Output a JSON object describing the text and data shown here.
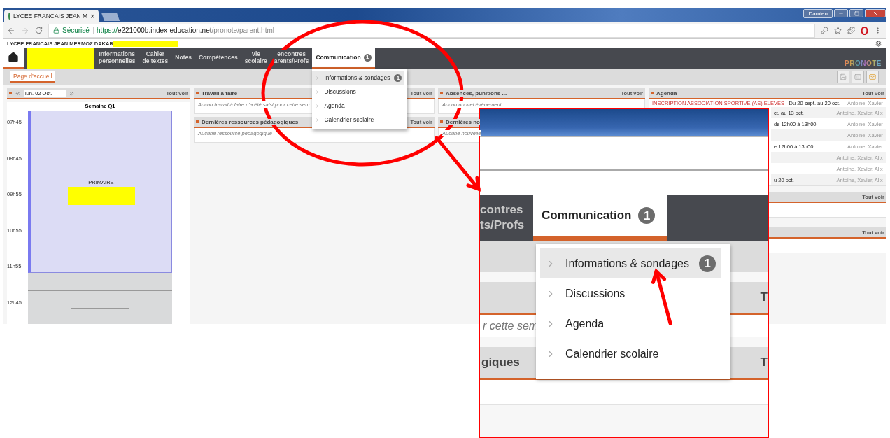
{
  "browser": {
    "tab_title": "LYCEE FRANCAIS JEAN M",
    "tab_close": "×",
    "user": "Damien",
    "secure_label": "Sécurisé",
    "url_scheme": "https://",
    "url_host": "e221000b.index-education.net",
    "url_path": "/pronote/parent.html"
  },
  "school_name": "LYCEE FRANCAIS JEAN MERMOZ DAKAR",
  "nav": {
    "items": [
      {
        "lines": [
          "Informations",
          "personnelles"
        ],
        "selected": false
      },
      {
        "lines": [
          "Cahier",
          "de textes"
        ],
        "selected": false
      },
      {
        "lines": [
          "Notes"
        ],
        "selected": false
      },
      {
        "lines": [
          "Compétences"
        ],
        "selected": false
      },
      {
        "lines": [
          "Vie",
          "scolaire"
        ],
        "selected": false
      },
      {
        "lines": [
          "encontres",
          "arents/Profs"
        ],
        "selected": false
      },
      {
        "lines": [
          "Communication"
        ],
        "badge": "1",
        "selected": true
      }
    ],
    "logo": "PRONOTE",
    "menu": [
      {
        "label": "Informations & sondages",
        "badge": "1",
        "selected": true
      },
      {
        "label": "Discussions",
        "selected": false
      },
      {
        "label": "Agenda",
        "selected": false
      },
      {
        "label": "Calendrier scolaire",
        "selected": false
      }
    ]
  },
  "subnav": {
    "tabs": [
      {
        "label": "Page d’accueil",
        "selected": true
      }
    ]
  },
  "calendar": {
    "date": "lun. 02 Oct.",
    "see_all": "Tout voir",
    "week": "Semaine Q1",
    "times": [
      "07h45",
      "08h45",
      "09h55",
      "10h55",
      "11h55",
      "12h45"
    ],
    "event": "PRIMAIRE"
  },
  "panel_columns": [
    [
      {
        "title": "Travail à faire",
        "see_all": "Tout voir",
        "empty": "Aucun travail à faire n'a été saisi pour cette sem"
      },
      {
        "title": "Dernières ressources pédagogiques",
        "see_all": "Tout voir",
        "empty": "Aucune ressource pédagogique"
      }
    ],
    [
      {
        "title": "Absences, punitions ...",
        "see_all": "Tout voir",
        "empty": "Aucun nouvel évènement"
      },
      {
        "title": "Dernières no",
        "empty": "Aucune nouvelle"
      }
    ]
  ],
  "agenda": {
    "title": "Agenda",
    "see_all": "Tout voir",
    "rows": [
      {
        "kind": "entry",
        "title": "INSCRIPTION ASSOCIATION SPORTIVE (AS) ELEVES",
        "text": " - Du 20 sept. au 20 oct.",
        "people": "Antoine, Xavier"
      },
      {
        "kind": "partial",
        "text": "ct. au 13 oct.",
        "people": "Antoine, Xavier, Alix"
      },
      {
        "kind": "partial",
        "text": "de 12h00 à 13h00",
        "people": "Antoine, Xavier"
      },
      {
        "kind": "partial",
        "people": "Antoine, Xavier"
      },
      {
        "kind": "partial",
        "text": "e 12h00 à 13h00",
        "people": "Antoine, Xavier"
      },
      {
        "kind": "partial",
        "people": "Antoine, Xavier, Alix"
      },
      {
        "kind": "partial",
        "people": "Antoine, Xavier, Alix"
      },
      {
        "kind": "partial",
        "text": "u 20 oct.",
        "people": "Antoine, Xavier, Alix"
      }
    ]
  },
  "side_panels": [
    {
      "see_all": "Tout voir"
    },
    {
      "see_all": "Tout voir"
    }
  ],
  "inset": {
    "nav_lines": [
      "contres",
      "ts/Profs"
    ],
    "tab_label": "Communication",
    "tab_badge": "1",
    "menu": [
      {
        "label": "Informations & sondages",
        "badge": "1",
        "selected": true
      },
      {
        "label": "Discussions",
        "selected": false
      },
      {
        "label": "Agenda",
        "selected": false
      },
      {
        "label": "Calendrier scolaire",
        "selected": false
      }
    ],
    "headers": [
      {
        "right": "T"
      },
      {
        "left": "giques",
        "right": "T"
      }
    ],
    "note": "r cette sem"
  }
}
